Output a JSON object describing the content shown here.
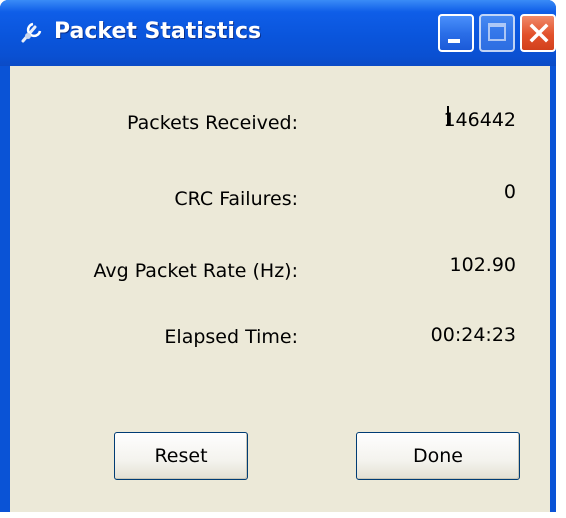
{
  "window": {
    "title": "Packet Statistics",
    "app_icon": "tools-icon",
    "controls": [
      "minimize-icon",
      "maximize-icon",
      "close-icon"
    ]
  },
  "stats": {
    "packets_received_label": "Packets Received:",
    "packets_received_value": "146442",
    "crc_failures_label": "CRC Failures:",
    "crc_failures_value": "0",
    "avg_rate_label": "Avg Packet Rate (Hz):",
    "avg_rate_value": "102.90",
    "elapsed_label": "Elapsed Time:",
    "elapsed_value": "00:24:23"
  },
  "buttons": {
    "reset_label": "Reset",
    "done_label": "Done"
  },
  "colors": {
    "titlebar": "#0a53d6",
    "client_background": "#ece9d8",
    "close_button": "#e2512b",
    "title_text": "#ffffff"
  }
}
